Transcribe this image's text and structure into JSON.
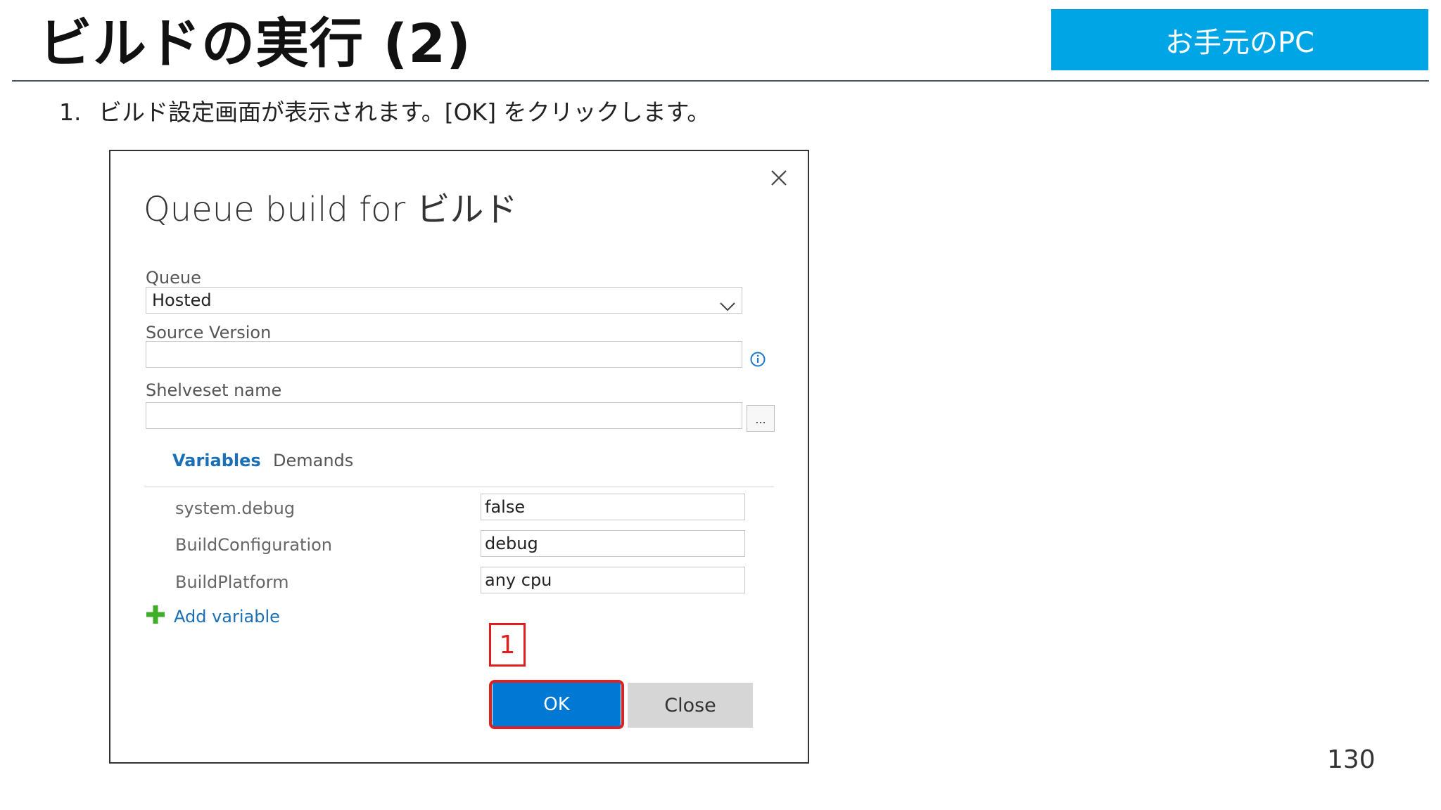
{
  "slide": {
    "title": "ビルドの実行 (2)",
    "badge": "お手元のPC",
    "step_number": "1.",
    "instruction": "ビルド設定画面が表示されます。[OK] をクリックします。",
    "page_number": "130"
  },
  "dialog": {
    "title": "Queue build for ビルド",
    "queue_label": "Queue",
    "queue_value": "Hosted",
    "source_version_label": "Source Version",
    "source_version_value": "",
    "shelveset_label": "Shelveset name",
    "shelveset_value": "",
    "ellipsis_label": "...",
    "tabs": [
      {
        "label": "Variables",
        "active": true
      },
      {
        "label": "Demands",
        "active": false
      }
    ],
    "variables": [
      {
        "name": "system.debug",
        "value": "false"
      },
      {
        "name": "BuildConfiguration",
        "value": "debug"
      },
      {
        "name": "BuildPlatform",
        "value": "any cpu"
      }
    ],
    "add_variable_label": "Add variable",
    "callout_number": "1",
    "ok_label": "OK",
    "close_label": "Close"
  },
  "colors": {
    "badge": "#00a5e5",
    "link": "#1b6fb6",
    "primary_button": "#0078d4",
    "highlight": "#e02020",
    "add_icon": "#3fae29"
  },
  "icons": {
    "dialog_close": "close-icon",
    "queue_dropdown": "chevron-down-icon",
    "source_info": "info-icon",
    "add_variable": "plus-icon"
  }
}
